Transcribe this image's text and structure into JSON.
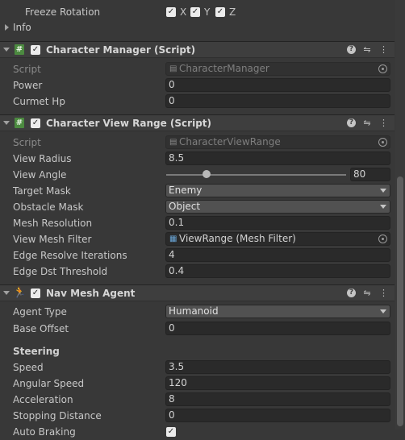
{
  "freeze_rotation": {
    "label": "Freeze Rotation",
    "axes": [
      {
        "name": "X",
        "checked": true
      },
      {
        "name": "Y",
        "checked": true
      },
      {
        "name": "Z",
        "checked": true
      }
    ]
  },
  "info": {
    "label": "Info"
  },
  "character_manager": {
    "title": "Character Manager (Script)",
    "enabled": true,
    "script_label": "Script",
    "script_value": "CharacterManager",
    "power_label": "Power",
    "power_value": "0",
    "hp_label": "Curmet Hp",
    "hp_value": "0"
  },
  "character_view_range": {
    "title": "Character View Range (Script)",
    "enabled": true,
    "script_label": "Script",
    "script_value": "CharacterViewRange",
    "view_radius_label": "View Radius",
    "view_radius_value": "8.5",
    "view_angle_label": "View Angle",
    "view_angle_value": "80",
    "view_angle_slider": {
      "min": 0,
      "max": 360,
      "value": 80
    },
    "target_mask_label": "Target Mask",
    "target_mask_value": "Enemy",
    "obstacle_mask_label": "Obstacle Mask",
    "obstacle_mask_value": "Object",
    "mesh_resolution_label": "Mesh Resolution",
    "mesh_resolution_value": "0.1",
    "view_mesh_filter_label": "View Mesh Filter",
    "view_mesh_filter_value": "ViewRange (Mesh Filter)",
    "edge_resolve_label": "Edge Resolve Iterations",
    "edge_resolve_value": "4",
    "edge_dst_label": "Edge Dst Threshold",
    "edge_dst_value": "0.4"
  },
  "nav_mesh_agent": {
    "title": "Nav Mesh Agent",
    "enabled": true,
    "agent_type_label": "Agent Type",
    "agent_type_value": "Humanoid",
    "base_offset_label": "Base Offset",
    "base_offset_value": "0",
    "steering_label": "Steering",
    "speed_label": "Speed",
    "speed_value": "3.5",
    "angular_speed_label": "Angular Speed",
    "angular_speed_value": "120",
    "acceleration_label": "Acceleration",
    "acceleration_value": "8",
    "stopping_distance_label": "Stopping Distance",
    "stopping_distance_value": "0",
    "auto_braking_label": "Auto Braking",
    "auto_braking_checked": true
  },
  "header_icons": {
    "help": "help-icon",
    "presets": "presets-icon",
    "menu": "more-menu-icon"
  },
  "colors": {
    "background": "#383838",
    "header": "#3e3e3e",
    "field": "#2a2a2a",
    "dropdown": "#515151",
    "script_icon": "#4c8a40",
    "nav_icon": "#e25d3a"
  }
}
